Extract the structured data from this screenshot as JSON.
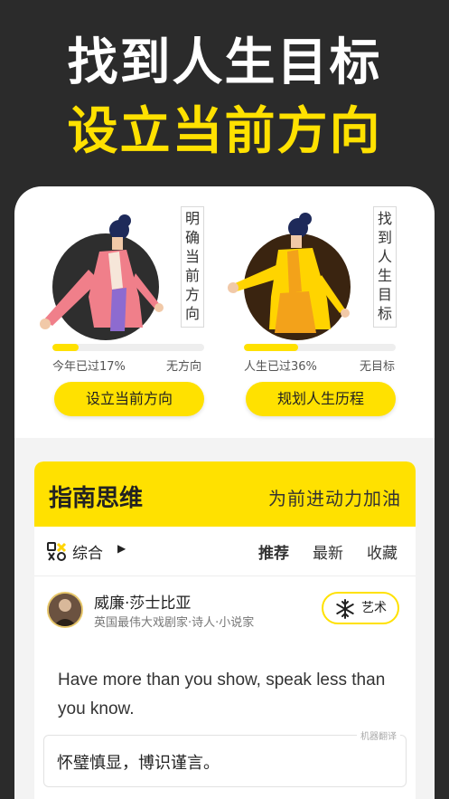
{
  "headline": {
    "line1": "找到人生目标",
    "line2": "设立当前方向"
  },
  "goals": [
    {
      "vertical_label": "明确当前方向",
      "progress_fraction": 0.17,
      "left_label": "今年已过17%",
      "right_label": "无方向",
      "button_label": "设立当前方向"
    },
    {
      "vertical_label": "找到人生目标",
      "progress_fraction": 0.36,
      "left_label": "人生已过36%",
      "right_label": "无目标",
      "button_label": "规划人生历程"
    }
  ],
  "guide": {
    "title": "指南思维",
    "slogan": "为前进动力加油",
    "filter": {
      "category": "综合",
      "tabs": [
        "推荐",
        "最新",
        "收藏"
      ],
      "active_tab": "推荐"
    },
    "author": {
      "name": "威廉·莎士比亚",
      "description": "英国最伟大戏剧家·诗人·小说家",
      "tag": "艺术"
    },
    "quote_en": "Have more than you show, speak less than you know.",
    "translation_badge": "机器翻译",
    "quote_cn": "怀璧慎显，博识谨言。"
  },
  "colors": {
    "accent": "#ffe100",
    "background": "#2b2b2b"
  }
}
